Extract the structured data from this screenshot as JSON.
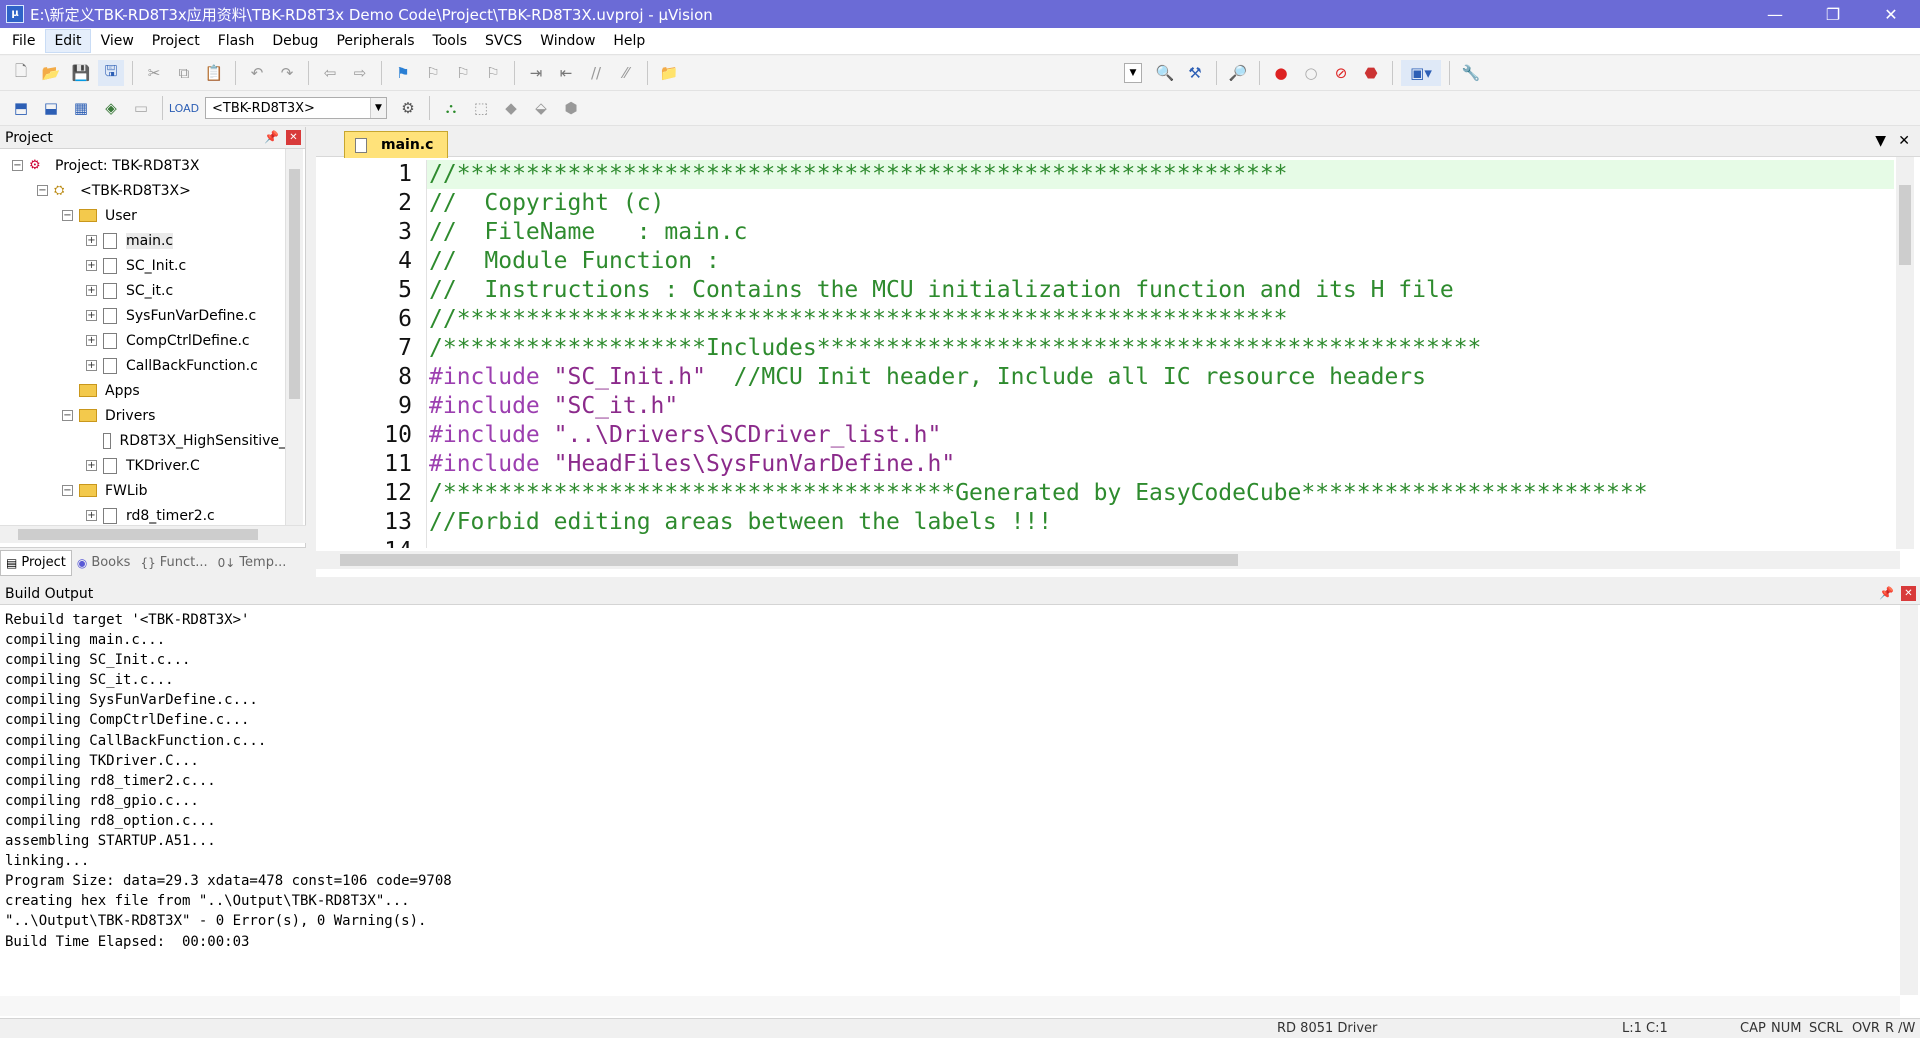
{
  "window": {
    "title": "E:\\新定义TBK-RD8T3x应用资料\\TBK-RD8T3x Demo Code\\Project\\TBK-RD8T3X.uvproj - µVision",
    "minimize": "—",
    "restore": "❐",
    "close": "✕"
  },
  "menu": [
    "File",
    "Edit",
    "View",
    "Project",
    "Flash",
    "Debug",
    "Peripherals",
    "Tools",
    "SVCS",
    "Window",
    "Help"
  ],
  "toolbar": {
    "target": "<TBK-RD8T3X>"
  },
  "project_panel": {
    "title": "Project",
    "tree": [
      {
        "label": "Project: TBK-RD8T3X",
        "level": 0,
        "kind": "project",
        "toggle": "−"
      },
      {
        "label": "<TBK-RD8T3X>",
        "level": 1,
        "kind": "target",
        "toggle": "−"
      },
      {
        "label": "User",
        "level": 2,
        "kind": "folder",
        "toggle": "−"
      },
      {
        "label": "main.c",
        "level": 3,
        "kind": "file",
        "toggle": "+",
        "selected": true
      },
      {
        "label": "SC_Init.c",
        "level": 3,
        "kind": "file",
        "toggle": "+"
      },
      {
        "label": "SC_it.c",
        "level": 3,
        "kind": "file",
        "toggle": "+"
      },
      {
        "label": "SysFunVarDefine.c",
        "level": 3,
        "kind": "file",
        "toggle": "+"
      },
      {
        "label": "CompCtrlDefine.c",
        "level": 3,
        "kind": "file",
        "toggle": "+"
      },
      {
        "label": "CallBackFunction.c",
        "level": 3,
        "kind": "file",
        "toggle": "+"
      },
      {
        "label": "Apps",
        "level": 2,
        "kind": "folder",
        "toggle": ""
      },
      {
        "label": "Drivers",
        "level": 2,
        "kind": "folder",
        "toggle": "−"
      },
      {
        "label": "RD8T3X_HighSensitive_",
        "level": 3,
        "kind": "file",
        "toggle": ""
      },
      {
        "label": "TKDriver.C",
        "level": 3,
        "kind": "file",
        "toggle": "+"
      },
      {
        "label": "FWLib",
        "level": 2,
        "kind": "folder",
        "toggle": "−"
      },
      {
        "label": "rd8_timer2.c",
        "level": 3,
        "kind": "file",
        "toggle": "+"
      }
    ],
    "tabs": [
      "Project",
      "Books",
      "Funct...",
      "Temp..."
    ]
  },
  "editor": {
    "tab": "main.c",
    "lines": [
      {
        "n": "1",
        "t": "//************************************************************",
        "cls": "c-comment",
        "current": true
      },
      {
        "n": "2",
        "t": "//  Copyright (c)",
        "cls": "c-comment"
      },
      {
        "n": "3",
        "t": "//  FileName   : main.c",
        "cls": "c-comment"
      },
      {
        "n": "4",
        "t": "//  Module Function :",
        "cls": "c-comment"
      },
      {
        "n": "5",
        "t": "//  Instructions : Contains the MCU initialization function and its H file",
        "cls": "c-comment"
      },
      {
        "n": "6",
        "t": "//************************************************************",
        "cls": "c-comment"
      },
      {
        "n": "7",
        "t": "/*******************Includes************************************************",
        "cls": "c-comment"
      },
      {
        "n": "8",
        "kw": "#include",
        "str": " \"SC_Init.h\"",
        "cm": "  //MCU Init header, Include all IC resource headers"
      },
      {
        "n": "9",
        "kw": "#include",
        "str": " \"SC_it.h\"",
        "cm": ""
      },
      {
        "n": "10",
        "kw": "#include",
        "str": " \"..\\Drivers\\SCDriver_list.h\"",
        "cm": ""
      },
      {
        "n": "11",
        "kw": "#include",
        "str": " \"HeadFiles\\SysFunVarDefine.h\"",
        "cm": ""
      },
      {
        "n": "12",
        "t": "/*************************************Generated by EasyCodeCube*************************",
        "cls": "c-comment"
      },
      {
        "n": "13",
        "t": "//Forbid editing areas between the labels !!!",
        "cls": "c-comment"
      },
      {
        "n": "14",
        "t": "",
        "cls": "c-comment"
      }
    ]
  },
  "build_output": {
    "title": "Build Output",
    "lines": [
      "Rebuild target '<TBK-RD8T3X>'",
      "compiling main.c...",
      "compiling SC_Init.c...",
      "compiling SC_it.c...",
      "compiling SysFunVarDefine.c...",
      "compiling CompCtrlDefine.c...",
      "compiling CallBackFunction.c...",
      "compiling TKDriver.C...",
      "compiling rd8_timer2.c...",
      "compiling rd8_gpio.c...",
      "compiling rd8_option.c...",
      "assembling STARTUP.A51...",
      "linking...",
      "Program Size: data=29.3 xdata=478 const=106 code=9708",
      "creating hex file from \"..\\Output\\TBK-RD8T3X\"...",
      "\"..\\Output\\TBK-RD8T3X\" - 0 Error(s), 0 Warning(s).",
      "Build Time Elapsed:  00:00:03"
    ]
  },
  "status": {
    "driver": "RD 8051 Driver",
    "position": "L:1 C:1",
    "cap": "CAP",
    "num": "NUM",
    "scrl": "SCRL",
    "ovr": "OVR",
    "rw": "R /W"
  }
}
